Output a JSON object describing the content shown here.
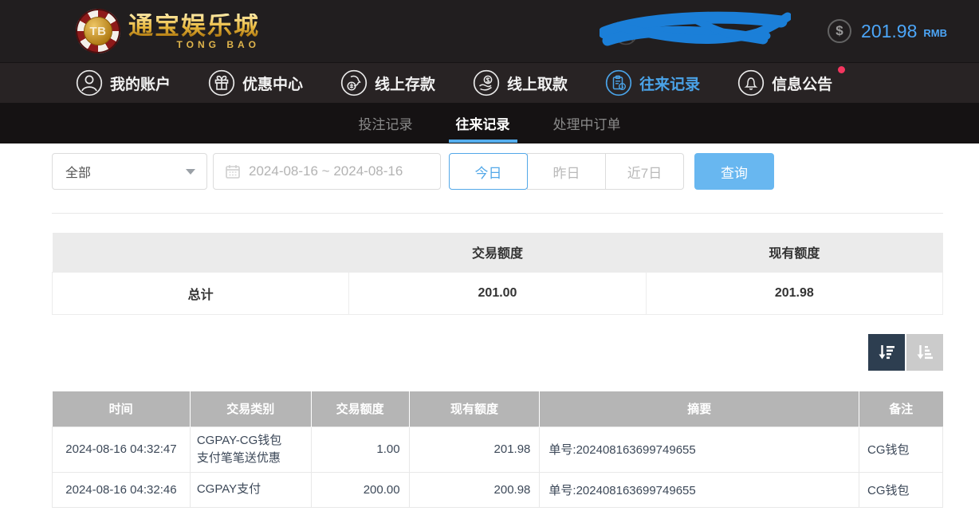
{
  "colors": {
    "accent": "#4aa3e8",
    "balance_text": "#4ca6f8",
    "query_button": "#68b7f0",
    "notice_dot": "#f4365f",
    "sort_active_bg": "#2d3e50",
    "sort_inactive_bg": "#cbcbcb",
    "table_header_bg": "#b5b5b5",
    "scribble": "#1b7fd8",
    "logo_gold": "#e0b54c"
  },
  "header": {
    "logo": {
      "chip_label": "TB",
      "title": "通宝娱乐城",
      "subtitle": "TONG BAO"
    },
    "balance": {
      "icon": "dollar-circle-icon",
      "amount": "201.98",
      "currency": "RMB"
    },
    "user": {
      "redacted": true
    }
  },
  "nav": {
    "items": [
      {
        "label": "我的账户",
        "icon": "user-icon",
        "active": false
      },
      {
        "label": "优惠中心",
        "icon": "gift-icon",
        "active": false
      },
      {
        "label": "线上存款",
        "icon": "deposit-icon",
        "active": false
      },
      {
        "label": "线上取款",
        "icon": "withdraw-icon",
        "active": false
      },
      {
        "label": "往来记录",
        "icon": "records-icon",
        "active": true
      },
      {
        "label": "信息公告",
        "icon": "bell-icon",
        "active": false,
        "has_badge": true
      }
    ]
  },
  "tabs": {
    "items": [
      {
        "label": "投注记录",
        "active": false
      },
      {
        "label": "往来记录",
        "active": true
      },
      {
        "label": "处理中订单",
        "active": false
      }
    ]
  },
  "filters": {
    "type_select": {
      "value": "全部"
    },
    "date_range": {
      "value": "2024-08-16 ~ 2024-08-16",
      "icon": "calendar-icon"
    },
    "quick_ranges": [
      {
        "label": "今日",
        "active": true
      },
      {
        "label": "昨日",
        "active": false
      },
      {
        "label": "近7日",
        "active": false
      }
    ],
    "query_label": "查询"
  },
  "summary_table": {
    "columns": [
      "",
      "交易额度",
      "现有额度"
    ],
    "total_row": {
      "label": "总计",
      "trade_amount": "201.00",
      "current_amount": "201.98"
    }
  },
  "sort_controls": {
    "descending_icon": "sort-descending-icon",
    "ascending_icon": "sort-ascending-icon"
  },
  "records_table": {
    "columns": [
      "时间",
      "交易类别",
      "交易额度",
      "现有额度",
      "摘要",
      "备注"
    ],
    "rows": [
      {
        "time": "2024-08-16 04:32:47",
        "type_lines": [
          "CGPAY-CG钱包",
          "支付笔笔送优惠"
        ],
        "amount": "1.00",
        "balance": "201.98",
        "summary": "单号:202408163699749655",
        "note": "CG钱包"
      },
      {
        "time": "2024-08-16 04:32:46",
        "type_lines": [
          "CGPAY支付",
          ""
        ],
        "amount": "200.00",
        "balance": "200.98",
        "summary": "单号:202408163699749655",
        "note": "CG钱包"
      }
    ]
  }
}
